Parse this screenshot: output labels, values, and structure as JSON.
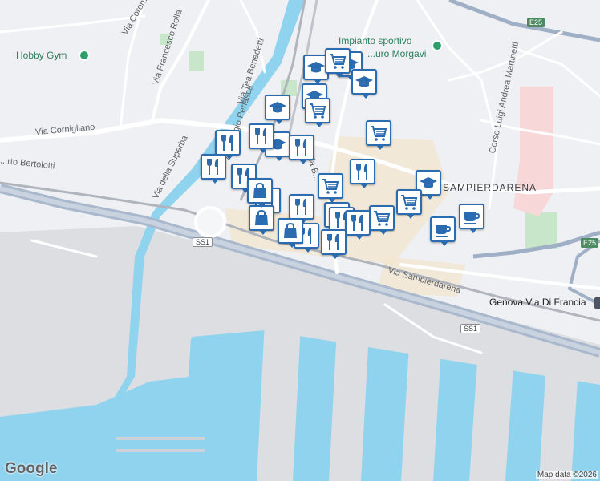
{
  "map": {
    "labels": {
      "hobby_gym": "Hobby Gym",
      "impianto_line1": "Impianto sportivo",
      "impianto_line2": "...uro Morgavi",
      "via_cornigliano": "Via Cornigliano",
      "via_francesco_rolla": "Via Francesco Rolla",
      "via_tea_benedetti": "Via Tea Benedetti",
      "via_giorgio_perlasca": "Via Giorgio Perlasca",
      "via_della_superba": "Via della Superba",
      "via_coron": "Via Coron...",
      "via_roberto_bertolotti": "...rto Bertolotti",
      "corso_martinetti": "Corso Luigi Andrea Martinetti",
      "sampierdarena": "SAMPIERDARENA",
      "via_sampierdarena": "Via Sampierdarena",
      "genova_via_di_francia": "Genova Via Di Francia",
      "via_b": "Via B..."
    },
    "road_shields": {
      "ss1_left": "SS1",
      "ss1_right": "SS1",
      "e25_top": "E25",
      "e25_right": "E25"
    },
    "icons": {
      "pin": "green-poi-pin-icon",
      "train": "train-station-icon"
    }
  },
  "markers": [
    {
      "type": "school",
      "icon": "graduation-cap-icon"
    },
    {
      "type": "school",
      "icon": "graduation-cap-icon"
    },
    {
      "type": "school",
      "icon": "graduation-cap-icon"
    },
    {
      "type": "school",
      "icon": "graduation-cap-icon"
    },
    {
      "type": "school",
      "icon": "graduation-cap-icon"
    },
    {
      "type": "school",
      "icon": "graduation-cap-icon"
    },
    {
      "type": "school",
      "icon": "graduation-cap-icon"
    },
    {
      "type": "grocery",
      "icon": "shopping-cart-icon"
    },
    {
      "type": "grocery",
      "icon": "shopping-cart-icon"
    },
    {
      "type": "grocery",
      "icon": "shopping-cart-icon"
    },
    {
      "type": "grocery",
      "icon": "shopping-cart-icon"
    },
    {
      "type": "grocery",
      "icon": "shopping-cart-icon"
    },
    {
      "type": "grocery",
      "icon": "shopping-cart-icon"
    },
    {
      "type": "grocery",
      "icon": "shopping-cart-icon"
    },
    {
      "type": "restaurant",
      "icon": "fork-knife-icon"
    },
    {
      "type": "restaurant",
      "icon": "fork-knife-icon"
    },
    {
      "type": "restaurant",
      "icon": "fork-knife-icon"
    },
    {
      "type": "restaurant",
      "icon": "fork-knife-icon"
    },
    {
      "type": "restaurant",
      "icon": "fork-knife-icon"
    },
    {
      "type": "restaurant",
      "icon": "fork-knife-icon"
    },
    {
      "type": "restaurant",
      "icon": "fork-knife-icon"
    },
    {
      "type": "restaurant",
      "icon": "fork-knife-icon"
    },
    {
      "type": "restaurant",
      "icon": "fork-knife-icon"
    },
    {
      "type": "restaurant",
      "icon": "fork-knife-icon"
    },
    {
      "type": "restaurant",
      "icon": "fork-knife-icon"
    },
    {
      "type": "restaurant",
      "icon": "fork-knife-icon"
    },
    {
      "type": "shopping",
      "icon": "shopping-bag-icon"
    },
    {
      "type": "shopping",
      "icon": "shopping-bag-icon"
    },
    {
      "type": "shopping",
      "icon": "shopping-bag-icon"
    },
    {
      "type": "cafe",
      "icon": "coffee-cup-icon"
    },
    {
      "type": "cafe",
      "icon": "coffee-cup-icon"
    }
  ],
  "footer": {
    "logo": "Google",
    "attribution": "Map data ©2026"
  }
}
